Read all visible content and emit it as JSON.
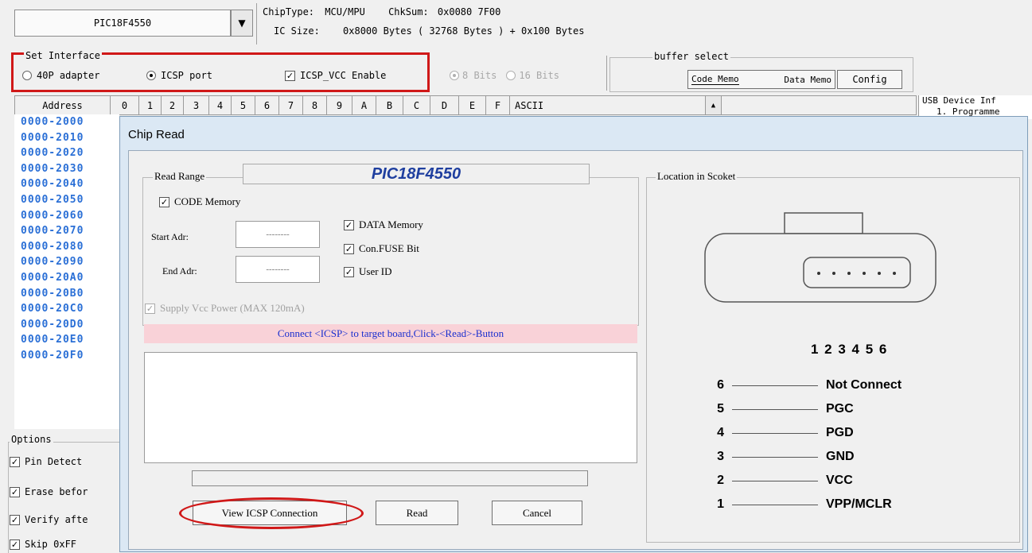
{
  "top": {
    "chip_name": "PIC18F4550",
    "chip_type_label": "ChipType:",
    "chip_type_value": "MCU/MPU",
    "checksum_label": "ChkSum:",
    "checksum_value": "0x0080 7F00",
    "ic_size_label": "IC Size:",
    "ic_size_value": "0x8000 Bytes ( 32768 Bytes ) + 0x100 Bytes"
  },
  "interface": {
    "title": "Set Interface",
    "opt_40p": "40P adapter",
    "opt_icsp": "ICSP port",
    "icsp_vcc": "ICSP_VCC Enable",
    "bits8": "8 Bits",
    "bits16": "16 Bits"
  },
  "buffer": {
    "title": "buffer select",
    "code_memo": "Code Memo",
    "data_memo": "Data Memo",
    "config": "Config"
  },
  "grid": {
    "address_header": "Address",
    "columns": [
      "0",
      "1",
      "2",
      "3",
      "4",
      "5",
      "6",
      "7",
      "8",
      "9",
      "A",
      "B",
      "C",
      "D",
      "E",
      "F"
    ],
    "ascii_header": "ASCII",
    "addresses": [
      "0000-2000",
      "0000-2010",
      "0000-2020",
      "0000-2030",
      "0000-2040",
      "0000-2050",
      "0000-2060",
      "0000-2070",
      "0000-2080",
      "0000-2090",
      "0000-20A0",
      "0000-20B0",
      "0000-20C0",
      "0000-20D0",
      "0000-20E0",
      "0000-20F0"
    ]
  },
  "usb_panel": {
    "title": "USB Device Inf",
    "line1": "1. Programme"
  },
  "options": {
    "title": "Options",
    "pin_detect": "Pin Detect",
    "erase_before": "Erase befor",
    "verify_after": "Verify afte",
    "skip_ff": "Skip 0xFF"
  },
  "dialog": {
    "title": "Chip Read",
    "read_range_title": "Read Range",
    "chip_name": "PIC18F4550",
    "code_memory": "CODE Memory",
    "data_memory": "DATA Memory",
    "con_fuse": "Con.FUSE Bit",
    "user_id": "User ID",
    "start_adr_label": "Start Adr:",
    "start_adr_value": "--------",
    "end_adr_label": "End Adr:",
    "end_adr_value": "--------",
    "supply_vcc": "Supply Vcc Power (MAX 120mA)",
    "message": "Connect <ICSP> to target board,Click-<Read>-Button",
    "location_title": "Location in Scoket",
    "pin_numbers": "1 2 3 4 5 6",
    "pins": [
      {
        "num": "6",
        "name": "Not Connect"
      },
      {
        "num": "5",
        "name": "PGC"
      },
      {
        "num": "4",
        "name": "PGD"
      },
      {
        "num": "3",
        "name": "GND"
      },
      {
        "num": "2",
        "name": "VCC"
      },
      {
        "num": "1",
        "name": "VPP/MCLR"
      }
    ],
    "btn_view": "View ICSP Connection",
    "btn_read": "Read",
    "btn_cancel": "Cancel"
  },
  "colors": {
    "highlight": "#d01818",
    "address_text": "#2a6fd6",
    "message_bg": "#f9d2d8",
    "message_text": "#1a2fcf"
  }
}
